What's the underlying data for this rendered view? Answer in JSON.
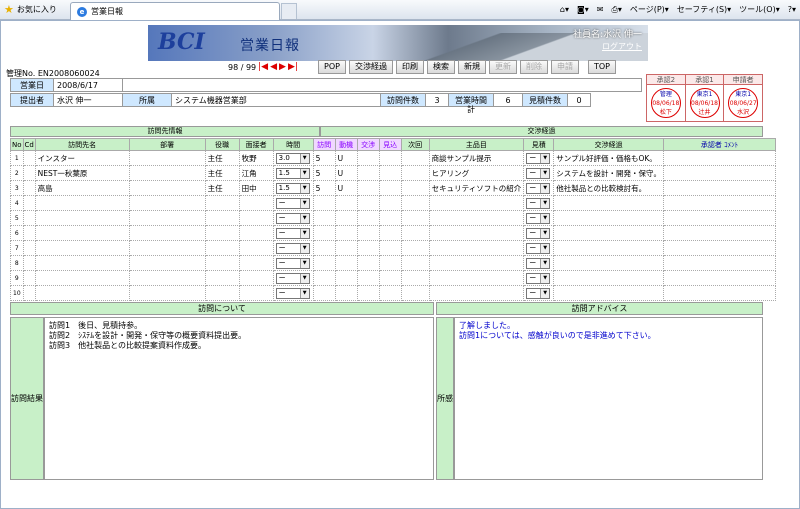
{
  "browser": {
    "favorites": "お気に入り",
    "tab_title": "営業日報",
    "menu": [
      "ページ(P)",
      "セーフティ(S)",
      "ツール(O)",
      "?"
    ]
  },
  "header": {
    "logo": "BCI",
    "title": "営業日報",
    "employee": "社員名:水沢 伸一",
    "logout": "ログアウト",
    "mgmt_no": "管理No. EN2008060024",
    "pager": "98 / 99"
  },
  "buttons": {
    "pop": "POP",
    "nego": "交渉経過",
    "print": "印刷",
    "search": "検索",
    "new": "新規",
    "update": "更新",
    "delete": "削除",
    "apply": "申請",
    "top": "TOP"
  },
  "approvals": [
    {
      "head": "承認2",
      "seal_top": "管理",
      "date": "08/06/18",
      "name": "松下"
    },
    {
      "head": "承認1",
      "seal_top": "東京1",
      "date": "08/06/18",
      "name": "辻井"
    },
    {
      "head": "申請者",
      "seal_top": "東京1",
      "date": "08/06/27",
      "name": "水沢"
    }
  ],
  "info": {
    "biz_date_label": "営業日",
    "biz_date": "2008/6/17",
    "submitter_label": "提出者",
    "submitter": "水沢 伸一",
    "dept_label": "所属",
    "dept": "システム機器営業部",
    "visits_label": "訪問件数",
    "visits": "3",
    "hours_label": "営業時間計",
    "hours": "6",
    "est_label": "見積件数",
    "est": "0"
  },
  "sections": {
    "visit_info": "訪問先情報",
    "nego_progress": "交渉経過"
  },
  "columns": [
    "No",
    "Cd",
    "訪問先名",
    "部署",
    "役職",
    "面接者",
    "時間",
    "訪問",
    "動機",
    "交渉",
    "見込",
    "次回",
    "主品目",
    "見積",
    "交渉経過",
    "承認者 ｺﾒﾝﾄ"
  ],
  "rows": [
    {
      "no": "1",
      "cd": "",
      "name": "インスター",
      "dept": "",
      "role": "主任",
      "person": "牧野",
      "time": "3.0",
      "visit": "5",
      "motive": "U",
      "item": "商談サンプル提示",
      "est": "ー",
      "progress": "サンプル好評価・価格もOK。"
    },
    {
      "no": "2",
      "cd": "",
      "name": "NEST一秋葉原",
      "dept": "",
      "role": "主任",
      "person": "江角",
      "time": "1.5",
      "visit": "5",
      "motive": "U",
      "item": "ヒアリング",
      "est": "ー",
      "progress": "システムを設計・開発・保守。"
    },
    {
      "no": "3",
      "cd": "",
      "name": "高島",
      "dept": "",
      "role": "主任",
      "person": "田中",
      "time": "1.5",
      "visit": "5",
      "motive": "U",
      "item": "セキュリティソフトの紹介",
      "est": "ー",
      "progress": "他社製品との比較検討有。"
    },
    {
      "no": "4",
      "cd": "",
      "name": "",
      "dept": "",
      "role": "",
      "person": "",
      "time": "ー",
      "visit": "",
      "motive": "",
      "item": "",
      "est": "ー",
      "progress": ""
    },
    {
      "no": "5",
      "cd": "",
      "name": "",
      "dept": "",
      "role": "",
      "person": "",
      "time": "ー",
      "visit": "",
      "motive": "",
      "item": "",
      "est": "ー",
      "progress": ""
    },
    {
      "no": "6",
      "cd": "",
      "name": "",
      "dept": "",
      "role": "",
      "person": "",
      "time": "ー",
      "visit": "",
      "motive": "",
      "item": "",
      "est": "ー",
      "progress": ""
    },
    {
      "no": "7",
      "cd": "",
      "name": "",
      "dept": "",
      "role": "",
      "person": "",
      "time": "ー",
      "visit": "",
      "motive": "",
      "item": "",
      "est": "ー",
      "progress": ""
    },
    {
      "no": "8",
      "cd": "",
      "name": "",
      "dept": "",
      "role": "",
      "person": "",
      "time": "ー",
      "visit": "",
      "motive": "",
      "item": "",
      "est": "ー",
      "progress": ""
    },
    {
      "no": "9",
      "cd": "",
      "name": "",
      "dept": "",
      "role": "",
      "person": "",
      "time": "ー",
      "visit": "",
      "motive": "",
      "item": "",
      "est": "ー",
      "progress": ""
    },
    {
      "no": "10",
      "cd": "",
      "name": "",
      "dept": "",
      "role": "",
      "person": "",
      "time": "ー",
      "visit": "",
      "motive": "",
      "item": "",
      "est": "ー",
      "progress": ""
    }
  ],
  "bottom": {
    "about_header": "訪問について",
    "advice_header": "訪問アドバイス",
    "result_label": "訪問結果",
    "comment_label": "所感",
    "result_lines": [
      "訪問1　後日、見積持参。",
      "訪問2　ｼｽﾃﾑを設計・開発・保守等の概要資料提出要。",
      "訪問3　他社製品との比較提案資料作成要。"
    ],
    "advice_lines": [
      "了解しました。",
      "訪問1については、感触が良いので是非進めて下さい。"
    ]
  }
}
